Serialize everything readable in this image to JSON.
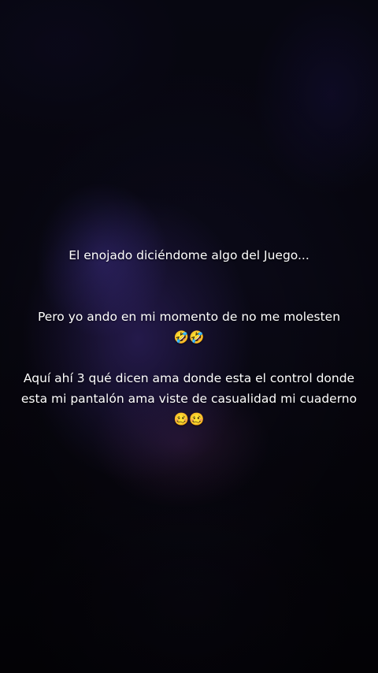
{
  "caption": {
    "line1": "El enojado diciéndome algo del Juego...",
    "line2": "Pero yo ando en mi momento de no me molesten",
    "line2_emoji": "🤣🤣",
    "line3": "Aquí ahí 3 qué dicen ama donde esta el control donde esta mi pantalón ama viste de casualidad mi cuaderno 🥴🥴"
  },
  "colors": {
    "text": "#ffffff",
    "background": "#06050c",
    "glow": "#3a2878"
  }
}
